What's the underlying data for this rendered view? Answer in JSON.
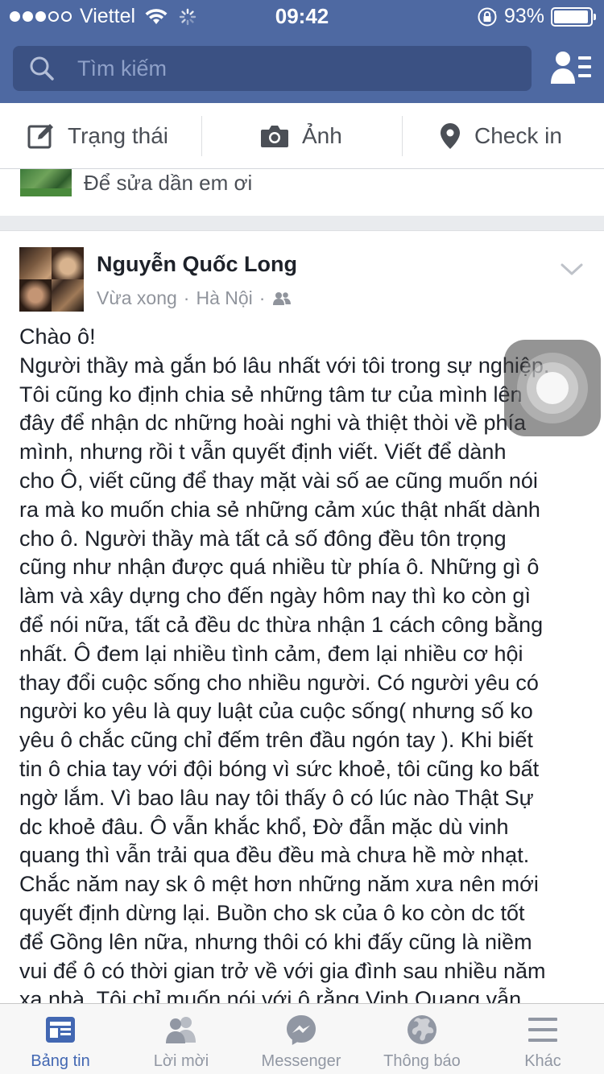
{
  "status_bar": {
    "carrier": "Viettel",
    "time": "09:42",
    "battery_percent": "93%",
    "signal_bars_filled": 3,
    "signal_bars_total": 5
  },
  "search": {
    "placeholder": "Tìm kiếm"
  },
  "composer": {
    "status_label": "Trạng thái",
    "photo_label": "Ảnh",
    "checkin_label": "Check in"
  },
  "previous_story": {
    "text": "Để sửa dần em ơi"
  },
  "post": {
    "author": "Nguyễn Quốc Long",
    "time": "Vừa xong",
    "separator": "·",
    "location": "Hà Nội",
    "body": "Chào ô!\nNgười thầy mà gắn bó lâu nhất với tôi trong sự nghiệp.\nTôi cũng ko định chia sẻ những tâm tư của mình lên\nđây để nhận dc những hoài nghi và thiệt thòi về phía\nmình, nhưng rồi t vẫn quyết định viết. Viết để dành\ncho Ô, viết cũng để thay mặt vài số ae cũng muốn nói\nra mà ko muốn chia sẻ những cảm xúc thật nhất dành\ncho ô. Người thầy mà tất cả số đông đều tôn trọng\ncũng như nhận được quá nhiều từ phía ô. Những gì ô\nlàm và xây dựng cho đến ngày hôm nay thì ko còn gì\nđể nói nữa, tất cả đều dc thừa nhận 1 cách công bằng\nnhất. Ô đem lại nhiều tình cảm, đem lại nhiều cơ hội\nthay đổi cuộc sống cho nhiều người. Có người yêu có\nngười ko yêu là quy luật của cuộc sống( nhưng số ko\nyêu ô chắc cũng chỉ đếm trên đầu ngón tay ). Khi biết\ntin ô chia tay với đội bóng vì sức khoẻ, tôi cũng ko bất\nngờ lắm. Vì bao lâu nay tôi thấy ô có lúc nào Thật Sự\ndc khoẻ đâu. Ô vẫn khắc khổ, Đờ đẫn mặc dù vinh\nquang thì vẫn trải qua đều đều mà chưa hề mờ nhạt.\nChắc năm nay sk ô mệt hơn những năm xưa nên mới\nquyết định dừng lại. Buồn cho sk của ô ko còn dc tốt\nđể Gồng lên nữa, nhưng thôi có khi đấy cũng là niềm\nvui để ô có thời gian trở về với gia đình sau nhiều năm\nxa nhà. Tôi chỉ muốn nói với ô rằng Vinh Quang vẫn"
  },
  "tabbar": {
    "items": [
      {
        "label": "Bảng tin",
        "icon": "news-feed-icon",
        "active": true
      },
      {
        "label": "Lời mời",
        "icon": "friend-requests-icon",
        "active": false
      },
      {
        "label": "Messenger",
        "icon": "messenger-icon",
        "active": false
      },
      {
        "label": "Thông báo",
        "icon": "globe-icon",
        "active": false
      },
      {
        "label": "Khác",
        "icon": "menu-icon",
        "active": false
      }
    ]
  },
  "colors": {
    "header_blue": "#4e69a2",
    "search_bg": "#3b5183",
    "active_tab": "#4267b2",
    "inactive_tab": "#9197a3"
  }
}
